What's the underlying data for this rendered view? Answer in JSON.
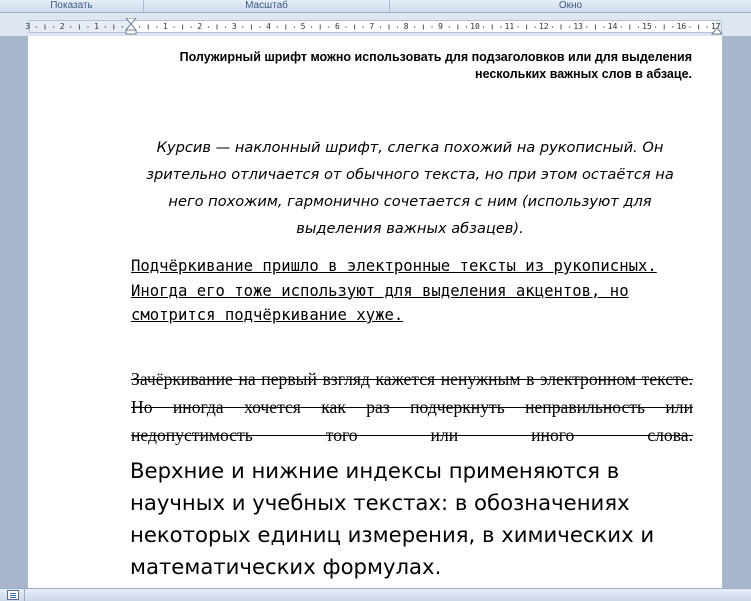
{
  "ribbon": {
    "groups": [
      {
        "label": "Показать"
      },
      {
        "label": "Масштаб"
      },
      {
        "label": "Окно"
      }
    ]
  },
  "ruler": {
    "labels_left": [
      "3",
      "2",
      "1"
    ],
    "labels_right": [
      "1",
      "2",
      "3",
      "4",
      "5",
      "6",
      "7",
      "8",
      "9",
      "10",
      "11",
      "12",
      "13",
      "14",
      "15",
      "16",
      "17"
    ]
  },
  "document": {
    "p_bold": "Полужирный шрифт можно использовать для подзаголовков или для выделения нескольких важных слов в абзаце.",
    "p_italic": "Курсив — наклонный шрифт, слегка похожий на рукописный. Он зрительно отличается от обычного текста, но при этом остаётся на него похожим, гармонично сочетается с ним (используют для выделения важных абзацев).",
    "p_underline": "Подчёркивание пришло в электронные тексты из рукописных. Иногда его тоже используют для выделения акцентов, но смотрится подчёркивание хуже.",
    "p_strike": "Зачёркивание на первый взгляд кажется ненужным в электронном тексте. Но иногда хочется как раз подчеркнуть неправильность или недопустимость того или иного слова.",
    "p_large": "Верхние и нижние индексы применяются в научных и учебных текстах: в обозначениях некоторых единиц измерения, в химических и математических формулах."
  },
  "status": {
    "view_icon": "print-layout-icon"
  }
}
